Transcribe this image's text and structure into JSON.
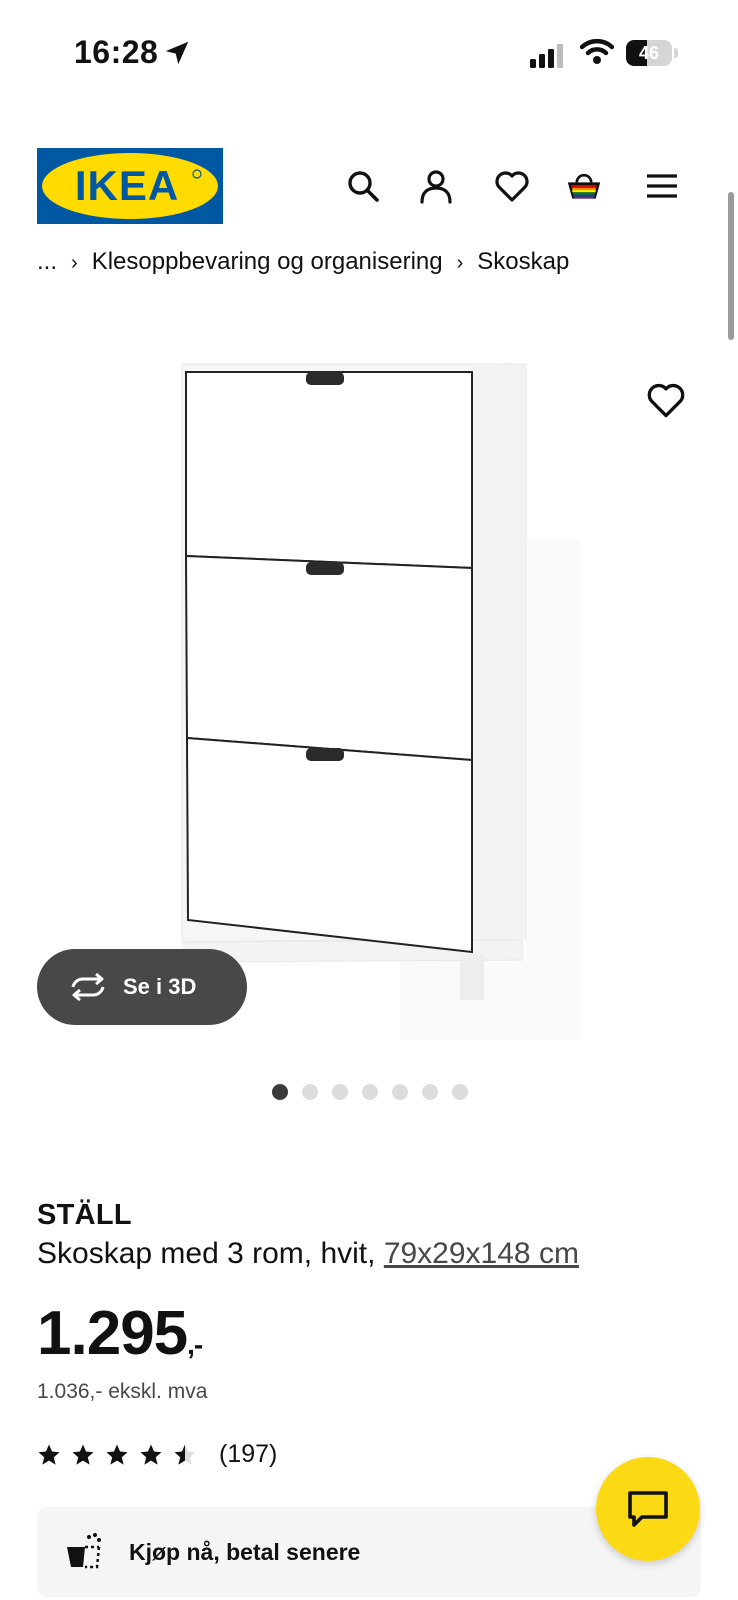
{
  "status_bar": {
    "time": "16:28",
    "battery": "46"
  },
  "header": {
    "logo_text": "IKEA",
    "icons": [
      "search-icon",
      "account-icon",
      "heart-icon",
      "cart-icon",
      "menu-icon"
    ]
  },
  "breadcrumb": {
    "items": [
      "...",
      "Klesoppbevaring og organisering",
      "Skoskap"
    ]
  },
  "gallery": {
    "view_3d_label": "Se i 3D",
    "image_count": 7,
    "active_index": 0
  },
  "product": {
    "name": "STÄLL",
    "description": "Skoskap med 3 rom, hvit, ",
    "dimensions": "79x29x148 cm",
    "price": "1.295",
    "price_suffix": ",-",
    "price_ex_vat": "1.036,- ekskl. mva",
    "rating": 4.5,
    "review_count": "(197)"
  },
  "bnpl": {
    "label": "Kjøp nå, betal senere"
  },
  "colors": {
    "ikea_blue": "#0058a3",
    "ikea_yellow": "#ffdb00",
    "chat_yellow": "#fbd914",
    "button_dark": "#484848"
  }
}
